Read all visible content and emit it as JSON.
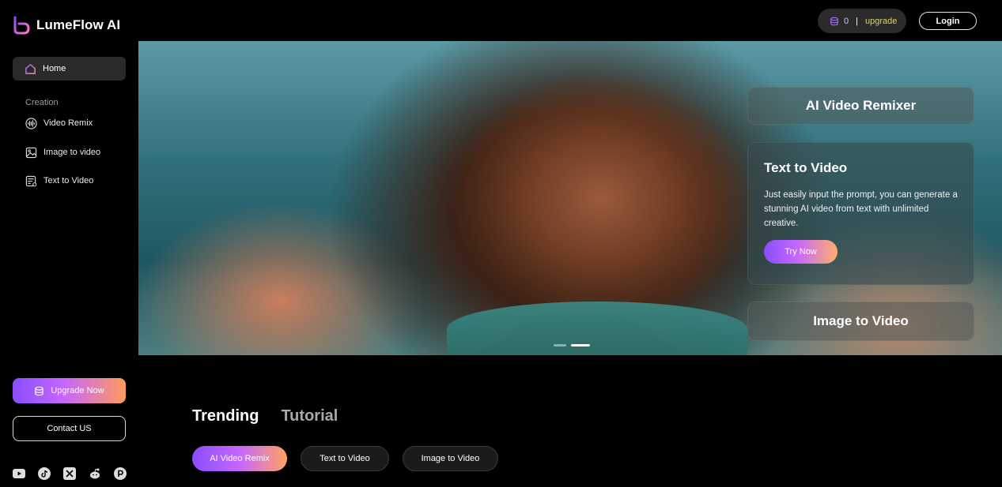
{
  "brand": {
    "name": "LumeFlow AI",
    "logo_icon": "logo-mark-icon"
  },
  "colors": {
    "accent_start": "#8b4dff",
    "accent_mid": "#c567ff",
    "accent_end": "#ff9a5c",
    "upgrade_text": "#e6d24a"
  },
  "sidebar": {
    "home": {
      "label": "Home",
      "icon": "home-icon"
    },
    "section_label": "Creation",
    "items": [
      {
        "label": "Video Remix",
        "icon": "waveform-icon"
      },
      {
        "label": "Image to video",
        "icon": "image-icon"
      },
      {
        "label": "Text to Video",
        "icon": "text-document-icon"
      }
    ],
    "upgrade_label": "Upgrade Now",
    "contact_label": "Contact US",
    "socials": [
      "youtube-icon",
      "tiktok-icon",
      "x-icon",
      "reddit-icon",
      "producthunt-icon"
    ]
  },
  "header": {
    "credits_count": "0",
    "credits_separator": "|",
    "upgrade_link": "upgrade",
    "login_label": "Login"
  },
  "hero": {
    "panels": {
      "remixer_title": "AI Video Remixer",
      "t2v_title": "Text to Video",
      "t2v_description": "Just easily input the prompt, you can generate a stunning AI video from text with unlimited creative.",
      "try_now_label": "Try Now",
      "i2v_title": "Image to Video"
    },
    "carousel_active_index": 1
  },
  "main": {
    "tabs": [
      {
        "label": "Trending",
        "active": true
      },
      {
        "label": "Tutorial",
        "active": false
      }
    ],
    "chips": [
      {
        "label": "AI Video Remix",
        "active": true
      },
      {
        "label": "Text to Video",
        "active": false
      },
      {
        "label": "Image to Video",
        "active": false
      }
    ]
  }
}
